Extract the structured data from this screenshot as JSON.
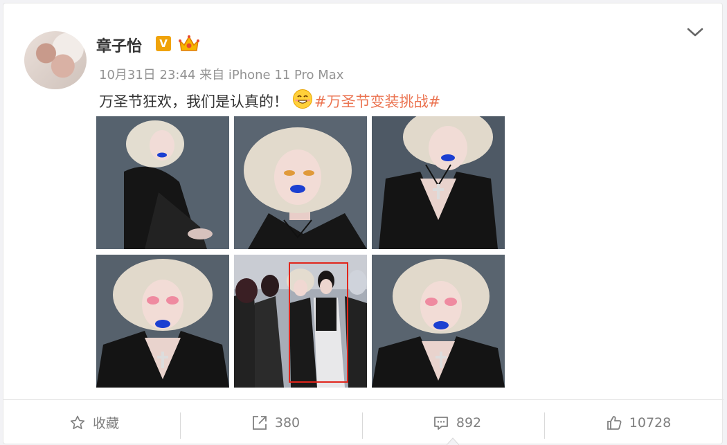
{
  "post": {
    "username": "章子怡",
    "verified_badge": "V",
    "timestamp": "10月31日 23:44",
    "source": "来自 iPhone 11 Pro Max",
    "text": "万圣节狂欢，我们是认真的！",
    "hashtag": "#万圣节变装挑战#",
    "photo_count": 6,
    "highlighted_photo": 5
  },
  "actions": {
    "favorite_label": "收藏",
    "repost_count": "380",
    "comment_count": "892",
    "like_count": "10728"
  },
  "colors": {
    "hashtag": "#eb7350",
    "badge": "#f0a30a",
    "highlight": "#e1251b"
  },
  "icons": [
    "crown-icon",
    "chevron-down-icon",
    "smile-emoji-icon",
    "star-icon",
    "repost-icon",
    "comment-icon",
    "thumbs-up-icon"
  ]
}
